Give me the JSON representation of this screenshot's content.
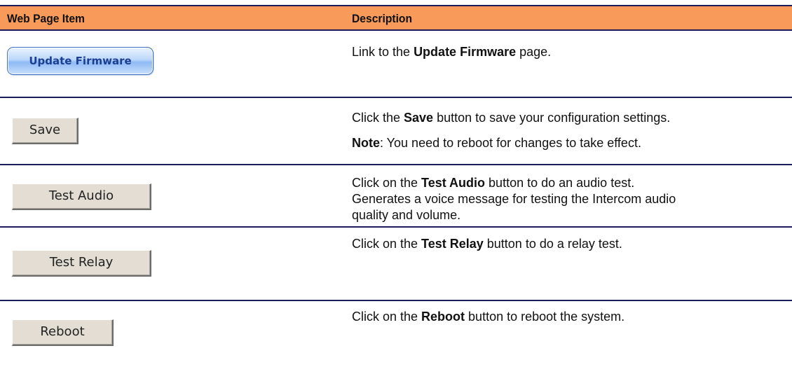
{
  "header": {
    "col1": "Web Page Item",
    "col2": "Description"
  },
  "rows": [
    {
      "button": "Update Firmware",
      "lines": [
        {
          "pre": "Link to the ",
          "bold": "Update Firmware",
          "post": " page."
        }
      ]
    },
    {
      "button": "Save",
      "lines": [
        {
          "pre": "Click the ",
          "bold": "Save",
          "post": " button to save your configuration settings."
        },
        {
          "pre": "",
          "bold": "Note",
          "post": ": You need to reboot for changes to take effect."
        }
      ]
    },
    {
      "button": "Test Audio",
      "lines": [
        {
          "pre": "Click on the ",
          "bold": "Test Audio",
          "post": " button to do an audio test."
        },
        {
          "pre": "Generates a voice message for testing the Intercom audio",
          "bold": "",
          "post": ""
        },
        {
          "pre": "quality and volume.",
          "bold": "",
          "post": ""
        }
      ]
    },
    {
      "button": "Test Relay",
      "lines": [
        {
          "pre": "Click on the ",
          "bold": "Test Relay",
          "post": " button to do a relay test."
        }
      ]
    },
    {
      "button": "Reboot",
      "lines": [
        {
          "pre": "Click on the ",
          "bold": "Reboot",
          "post": " button to reboot the system."
        }
      ]
    }
  ],
  "colors": {
    "header_bg": "#f79a5a",
    "rule": "#1b1b5a"
  }
}
